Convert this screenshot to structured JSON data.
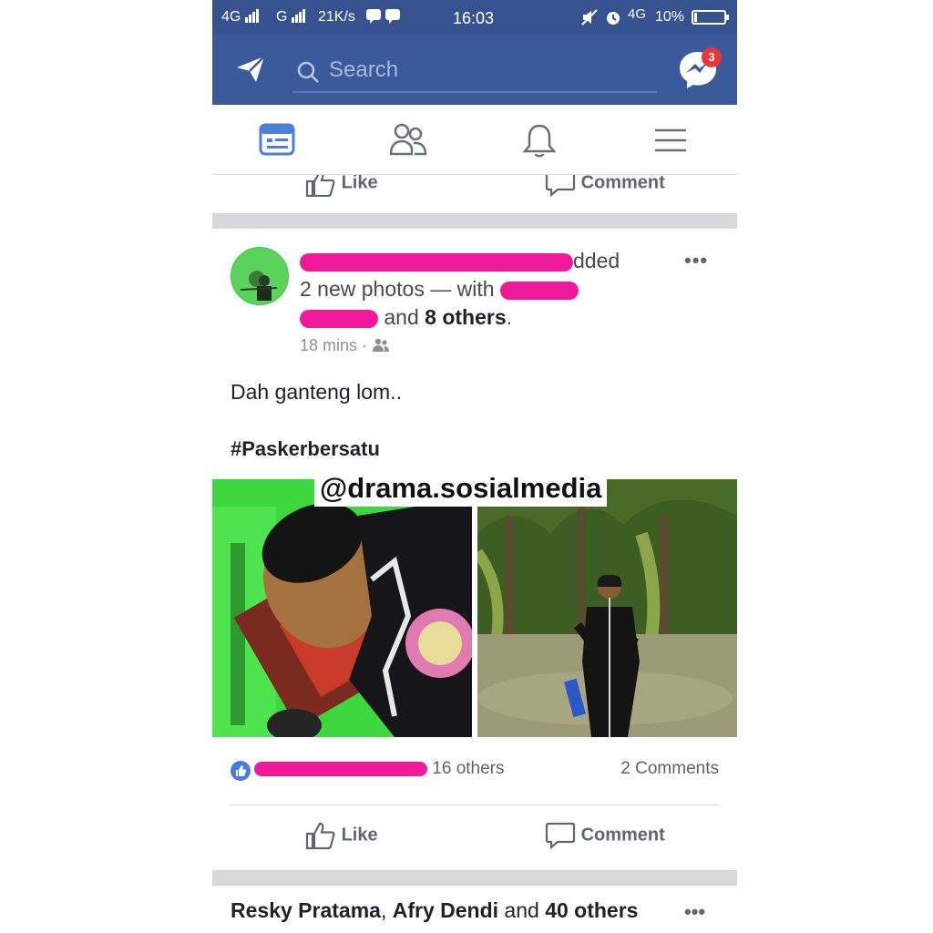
{
  "status_bar": {
    "network_1": "4G",
    "network_2": "G",
    "speed": "21K/s",
    "time": "16:03",
    "network_3": "4G",
    "battery": "10%"
  },
  "header": {
    "search_placeholder": "Search",
    "messenger_badge": "3"
  },
  "tabs": [
    "news-feed",
    "friends",
    "notifications",
    "menu"
  ],
  "previous_post": {
    "like_label": "Like",
    "comment_label": "Comment"
  },
  "post": {
    "author_suffix": "dded",
    "line2_prefix": "2 new photos — with",
    "line3_and": "and",
    "line3_others": "8 others",
    "line3_end": ".",
    "time": "18 mins",
    "time_separator": "·",
    "audience_icon": "friends-icon",
    "text": "Dah ganteng lom..",
    "hashtag": "#Paskerbersatu",
    "watermark": "@drama.sosialmedia",
    "reaction_text": "16 others",
    "comment_count": "2 Comments",
    "like_label": "Like",
    "comment_label": "Comment"
  },
  "next_post": {
    "name1": "Resky Pratama",
    "sep": ",",
    "name2": "Afry Dendi",
    "and": "and",
    "others": "40 others"
  },
  "colors": {
    "facebook_blue": "#3b5a9b",
    "status_blue": "#36528f",
    "redaction_pink": "#f0199a",
    "badge_red": "#e9363a"
  }
}
